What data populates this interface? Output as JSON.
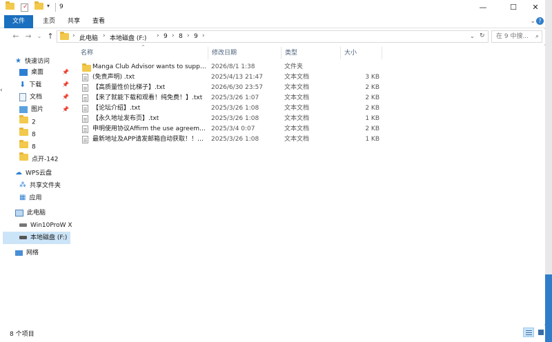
{
  "window": {
    "title": "9"
  },
  "ribbon": {
    "tabs": [
      "文件",
      "主页",
      "共享",
      "查看"
    ],
    "expand_glyph": "⌄",
    "help_glyph": "?"
  },
  "address": {
    "segments": [
      "此电脑",
      "本地磁盘 (F:)",
      "9",
      "8",
      "9"
    ],
    "refresh_glyph": "↻"
  },
  "search": {
    "placeholder": "在 9 中搜..."
  },
  "sidebar": {
    "quick_access": "快速访问",
    "pinned": [
      "桌面",
      "下载",
      "文档",
      "图片"
    ],
    "folders": [
      "2",
      "8",
      "8",
      "点开-142"
    ],
    "wps": "WPS云盘",
    "wps_items": [
      "共享文件夹",
      "应用"
    ],
    "this_pc": "此电脑",
    "drives": [
      "Win10ProW X",
      "本地磁盘 (F:)"
    ],
    "network": "网络"
  },
  "columns": {
    "name": "名称",
    "date": "修改日期",
    "type": "类型",
    "size": "大小"
  },
  "files": [
    {
      "name": "Manga Club Advisor wants to suppo...",
      "date": "2026/8/1 1:38",
      "type": "文件夹",
      "size": "",
      "kind": "folder"
    },
    {
      "name": "(免责声明) .txt",
      "date": "2025/4/13 21:47",
      "type": "文本文档",
      "size": "3 KB",
      "kind": "txt"
    },
    {
      "name": "【高质量性价比梯子】.txt",
      "date": "2026/6/30 23:57",
      "type": "文本文档",
      "size": "2 KB",
      "kind": "txt"
    },
    {
      "name": "【来了就能下载和观看！纯免费！】.txt",
      "date": "2025/3/26 1:07",
      "type": "文本文档",
      "size": "2 KB",
      "kind": "txt"
    },
    {
      "name": "【论坛介绍】.txt",
      "date": "2025/3/26 1:08",
      "type": "文本文档",
      "size": "2 KB",
      "kind": "txt"
    },
    {
      "name": "【永久地址发布页】.txt",
      "date": "2025/3/26 1:08",
      "type": "文本文档",
      "size": "1 KB",
      "kind": "txt"
    },
    {
      "name": "申明使用协议Affirm the use agreemen...",
      "date": "2025/3/4 0:07",
      "type": "文本文档",
      "size": "2 KB",
      "kind": "txt"
    },
    {
      "name": "最新地址及APP请发邮箱自动获取！！！...",
      "date": "2025/3/26 1:08",
      "type": "文本文档",
      "size": "1 KB",
      "kind": "txt"
    }
  ],
  "status": {
    "count": "8 个项目"
  },
  "colors": {
    "accent": "#1a6fbf",
    "folder": "#f2c94c",
    "selection": "#cce4f7"
  }
}
